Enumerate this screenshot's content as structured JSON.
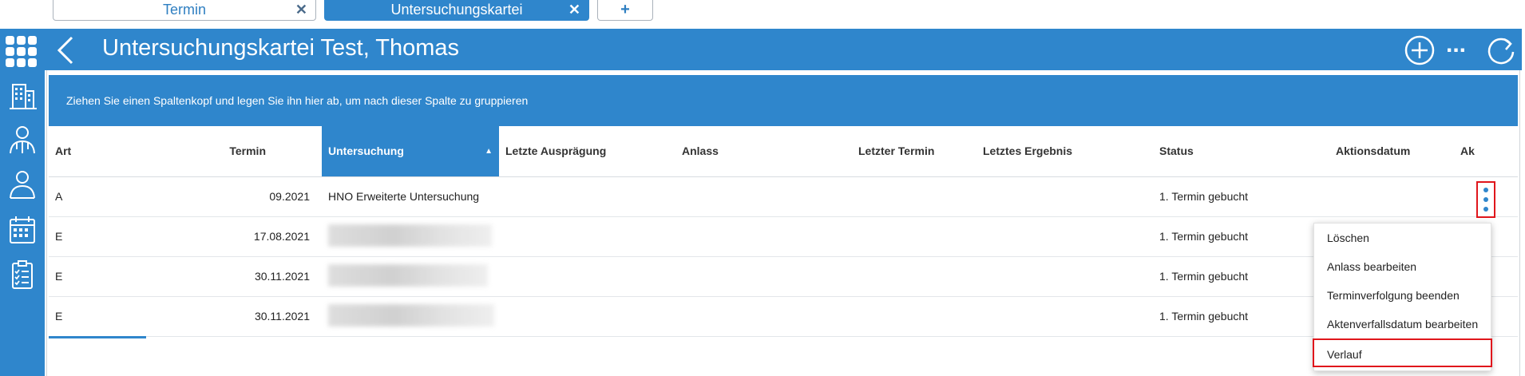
{
  "tabs": [
    {
      "label": "Termin",
      "close": "✕"
    },
    {
      "label": "Untersuchungskartei",
      "close": "✕"
    }
  ],
  "add_tab_label": "+",
  "header": {
    "title": "Untersuchungskartei Test, Thomas",
    "more_label": "..."
  },
  "sidebar": {
    "items": [
      "building-icon",
      "doctor-icon",
      "patient-icon",
      "calendar-icon",
      "checklist-icon"
    ]
  },
  "group_panel_text": "Ziehen Sie einen Spaltenkopf und legen Sie ihn hier ab, um nach dieser Spalte zu gruppieren",
  "columns": [
    {
      "label": "Art"
    },
    {
      "label": "Termin"
    },
    {
      "label": "Untersuchung",
      "sort": "ascending"
    },
    {
      "label": "Letzte Ausprägung"
    },
    {
      "label": "Anlass"
    },
    {
      "label": "Letzter Termin"
    },
    {
      "label": "Letztes Ergebnis"
    },
    {
      "label": "Status"
    },
    {
      "label": "Aktionsdatum"
    },
    {
      "label": "Ak"
    }
  ],
  "sort_arrow": "▲",
  "rows": [
    {
      "art": "A",
      "termin": "09.2021",
      "untersuchung": "HNO Erweiterte Untersuchung",
      "status": "1. Termin gebucht"
    },
    {
      "art": "E",
      "termin": "17.08.2021",
      "untersuchung": "",
      "status": "1. Termin gebucht"
    },
    {
      "art": "E",
      "termin": "30.11.2021",
      "untersuchung": "",
      "status": "1. Termin gebucht"
    },
    {
      "art": "E",
      "termin": "30.11.2021",
      "untersuchung": "",
      "status": "1. Termin gebucht"
    }
  ],
  "context_menu": {
    "items": [
      "Löschen",
      "Anlass bearbeiten",
      "Terminverfolgung beenden",
      "Aktenverfallsdatum bearbeiten",
      "Verlauf"
    ]
  },
  "colors": {
    "accent": "#2f86cc",
    "highlight_border": "#e0161c"
  }
}
